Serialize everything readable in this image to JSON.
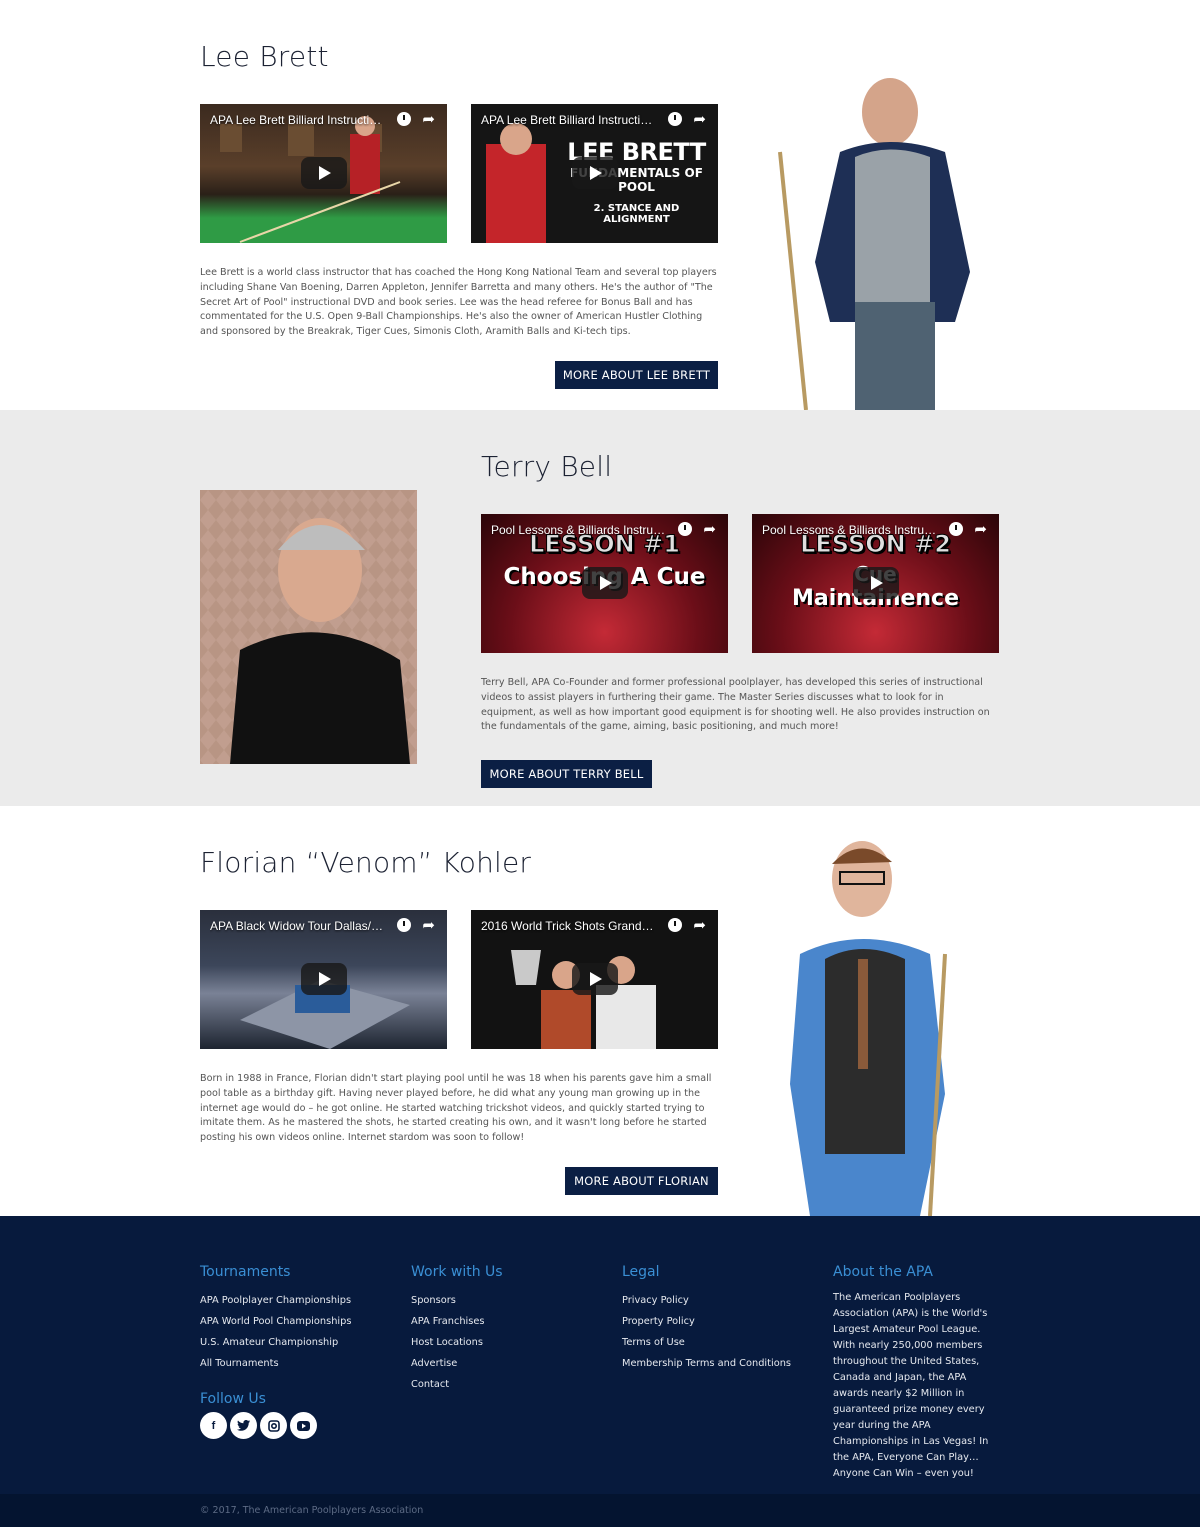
{
  "instructors": [
    {
      "name": "Lee Brett",
      "videos": [
        {
          "title": "APA Lee Brett Billiard Instructio...",
          "bg": "#3a2a1e",
          "accent": "#2e9b44"
        },
        {
          "title": "APA Lee Brett Billiard Instructio...",
          "bg": "#1b1b1b",
          "accent": "#c4252a",
          "overlay_text": [
            "LEE BRETT",
            "FUNDAMENTALS OF POOL",
            "2. STANCE AND ALIGNMENT"
          ]
        }
      ],
      "bio": "Lee Brett is a world class instructor that has coached the Hong Kong National Team and several top players including Shane Van Boening, Darren Appleton, Jennifer Barretta and many others. He's the author of \"The Secret Art of Pool\" instructional DVD and book series. Lee was the head referee for Bonus Ball and has commentated for the U.S. Open 9-Ball Championships. He's also the owner of American Hustler Clothing and sponsored by the Breakrak, Tiger Cues, Simonis Cloth, Aramith Balls and Ki-tech tips.",
      "button": "MORE ABOUT LEE BRETT"
    },
    {
      "name": "Terry Bell",
      "videos": [
        {
          "title": "Pool Lessons & Billiards Instruct...",
          "bg": "#5a0d14",
          "accent": "#b41e2c",
          "overlay_text": [
            "LESSON #1",
            "Choosing A Cue"
          ]
        },
        {
          "title": "Pool Lessons & Billiards Instruct...",
          "bg": "#5a0d14",
          "accent": "#b41e2c",
          "overlay_text": [
            "LESSON #2",
            "Cue",
            "Maintainence"
          ]
        }
      ],
      "bio": "Terry Bell, APA Co-Founder and former professional poolplayer, has developed this series of instructional videos to assist players in furthering their game. The Master Series discusses what to look for in equipment, as well as how important good equipment is for shooting well. He also provides instruction on the fundamentals of the game, aiming, basic positioning, and much more!",
      "button": "MORE ABOUT TERRY BELL"
    },
    {
      "name": "Florian “Venom” Kohler",
      "videos": [
        {
          "title": "APA Black Widow Tour Dallas/M...",
          "bg": "#1d2430",
          "accent": "#5a6b8a"
        },
        {
          "title": "2016 World Trick Shots Grand P...",
          "bg": "#141414",
          "accent": "#b04a2a"
        }
      ],
      "bio": "Born in 1988 in France, Florian didn't start playing pool until he was 18 when his parents gave him a small pool table as a birthday gift. Having never played before, he did what any young man growing up in the internet age would do – he got online. He started watching trickshot videos, and quickly started trying to imitate them. As he mastered the shots, he started creating his own, and it wasn't long before he started posting his own videos online. Internet stardom was soon to follow!",
      "button": "MORE ABOUT FLORIAN"
    }
  ],
  "footer": {
    "tournaments": {
      "heading": "Tournaments",
      "links": [
        "APA Poolplayer Championships",
        "APA World Pool Championships",
        "U.S. Amateur Championship",
        "All Tournaments"
      ]
    },
    "follow": {
      "heading": "Follow Us",
      "icons": [
        "facebook-icon",
        "twitter-icon",
        "instagram-icon",
        "youtube-icon"
      ]
    },
    "work": {
      "heading": "Work with Us",
      "links": [
        "Sponsors",
        "APA Franchises",
        "Host Locations",
        "Advertise",
        "Contact"
      ]
    },
    "legal": {
      "heading": "Legal",
      "links": [
        "Privacy Policy",
        "Property Policy",
        "Terms of Use",
        "Membership Terms and Conditions"
      ]
    },
    "about": {
      "heading": "About the APA",
      "text": "The American Poolplayers Association (APA) is the World's Largest Amateur Pool League. With nearly 250,000 members throughout the United States, Canada and Japan, the APA awards nearly $2 Million in guaranteed prize money every year during the APA Championships in Las Vegas! In the APA, Everyone Can Play… Anyone Can Win – even you!"
    },
    "copyright": "© 2017, The American Poolplayers Association"
  },
  "colors": {
    "navy": "#0b1f44",
    "footer_bg": "#071a3d",
    "footer_heading": "#3a8fd4",
    "gray_section": "#ebebeb"
  }
}
